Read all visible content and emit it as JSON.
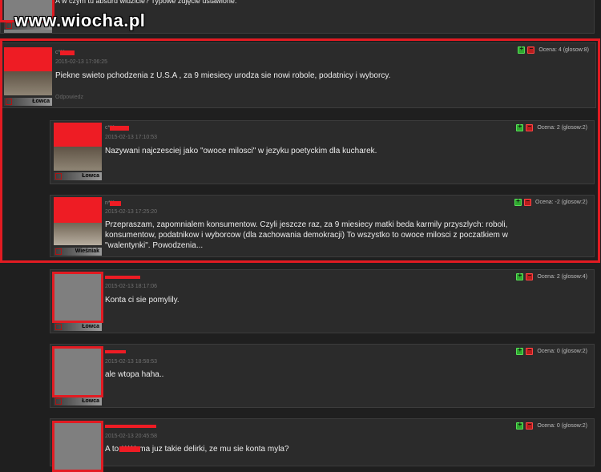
{
  "top_snippet": {
    "text": "A w czym tu absurd widzicie? Typowe zdjęcie ustawione."
  },
  "watermark": "www.wiocha.pl",
  "comments": [
    {
      "author": "c***a",
      "date": "2015-02-13 17:06:25",
      "text": "Piekne swieto pchodzenia z U.S.A , za 9 miesiecy urodza sie nowi robole, podatnicy i wyborcy.",
      "rank": "Łowca",
      "score": "Ocena: 4 (glosow:8)",
      "reply": "Odpowiedz"
    },
    {
      "author": "c***a",
      "date": "2015-02-13 17:10:53",
      "text": "Nazywani najczesciej jako \"owoce milosci\" w jezyku poetyckim dla kucharek.",
      "rank": "Łowca",
      "score": "Ocena: 2 (glosow:2)"
    },
    {
      "author": "n***n",
      "date": "2015-02-13 17:25:20",
      "text": "Przepraszam, zapomnialem konsumentow. Czyli jeszcze raz, za 9 miesiecy matki beda karmily przyszlych: roboli, konsumentow, podatnikow i wyborcow (dla zachowania demokracji) To wszystko to owoce milosci z poczatkiem w \"walentynki\". Powodzenia...",
      "rank": "Wieśniak",
      "score": "Ocena: -2 (glosow:2)"
    },
    {
      "date": "2015-02-13 18:17:06",
      "text": "Konta ci sie pomylily.",
      "rank": "Łowca",
      "score": "Ocena: 2 (glosow:4)"
    },
    {
      "date": "2015-02-13 18:58:53",
      "text": "ale wtopa haha..",
      "rank": "Łowca",
      "score": "Ocena: 0 (glosow:2)"
    },
    {
      "date": "2015-02-13 20:45:58",
      "text": "A to ***** ma juz takie delirki, ze mu sie konta myla?",
      "score": "Ocena: 0 (glosow:2)"
    }
  ],
  "colors": {
    "highlight": "#e21b22",
    "vote_up": "#2fa82f",
    "vote_down": "#b81d1d"
  }
}
